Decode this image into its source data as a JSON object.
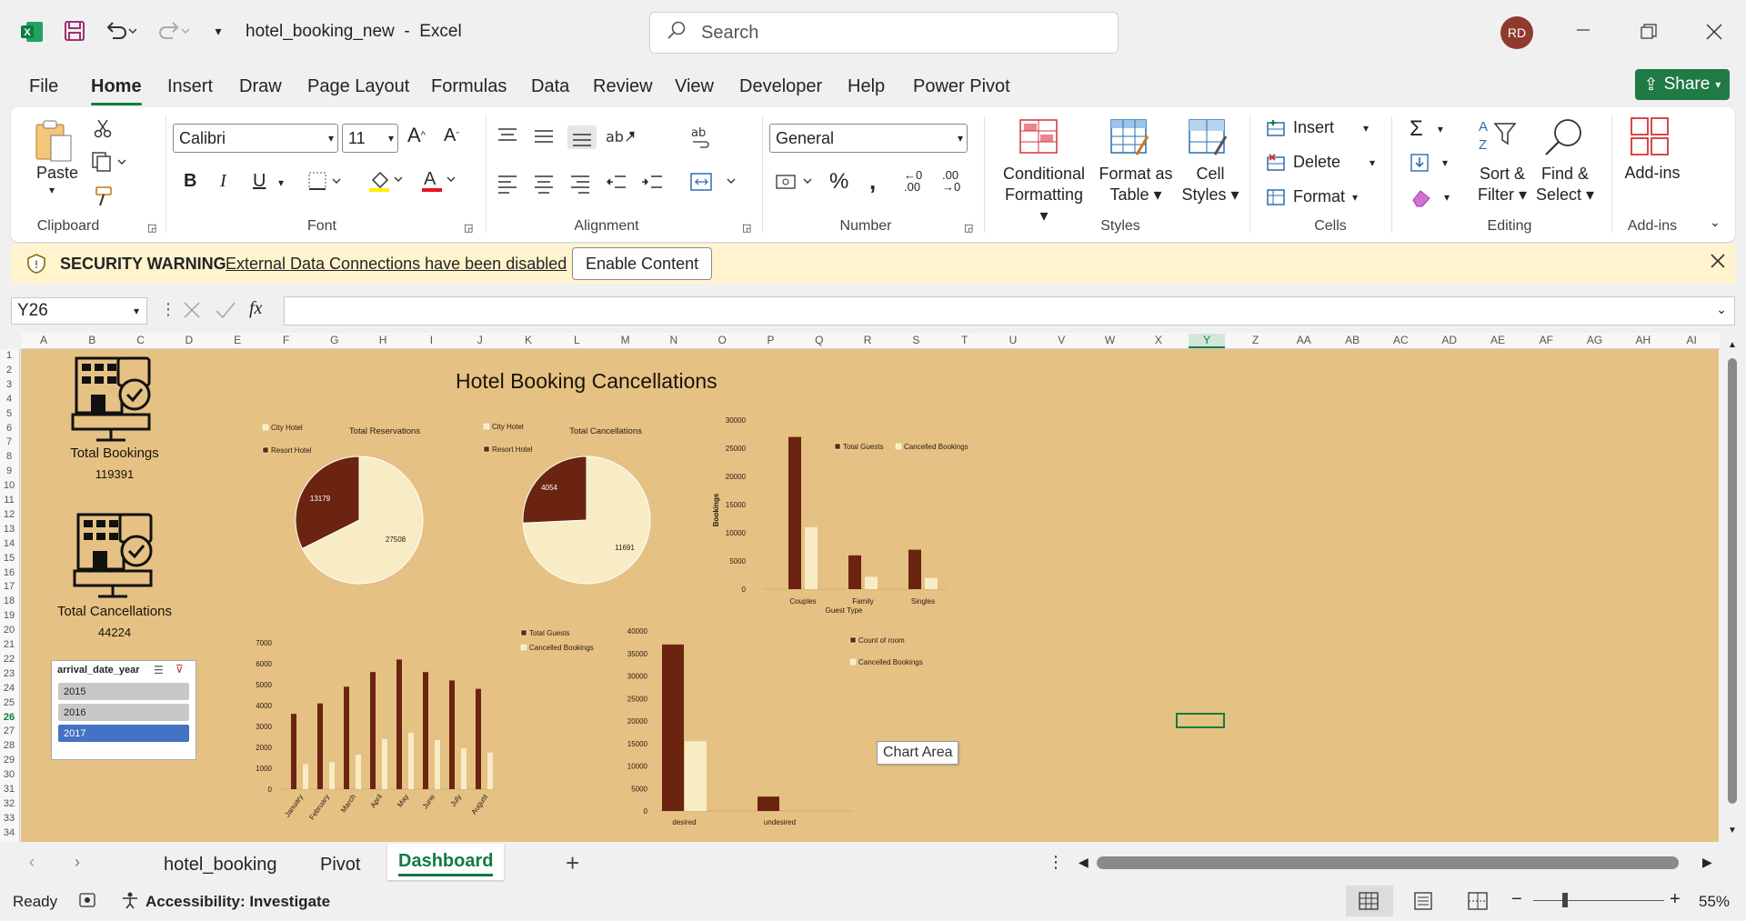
{
  "app": {
    "title": "hotel_booking_new",
    "app_name": "Excel",
    "title_sep": "-",
    "user_initials": "RD",
    "search_placeholder": "Search"
  },
  "menu_tabs": [
    "File",
    "Home",
    "Insert",
    "Draw",
    "Page Layout",
    "Formulas",
    "Data",
    "Review",
    "View",
    "Developer",
    "Help",
    "Power Pivot"
  ],
  "share_label": "Share",
  "ribbon": {
    "clipboard": {
      "paste": "Paste",
      "label": "Clipboard"
    },
    "font": {
      "name": "Calibri",
      "size": "11",
      "label": "Font",
      "bold": "B",
      "italic": "I",
      "underline": "U"
    },
    "alignment": {
      "label": "Alignment"
    },
    "number": {
      "format": "General",
      "label": "Number"
    },
    "styles": {
      "cond1": "Conditional",
      "cond2": "Formatting",
      "fmt1": "Format as",
      "fmt2": "Table",
      "cell1": "Cell",
      "cell2": "Styles",
      "label": "Styles"
    },
    "cells": {
      "insert": "Insert",
      "delete": "Delete",
      "format": "Format",
      "label": "Cells"
    },
    "editing": {
      "sort1": "Sort &",
      "sort2": "Filter",
      "find1": "Find &",
      "find2": "Select",
      "label": "Editing"
    },
    "addins": {
      "btn": "Add-ins",
      "label": "Add-ins"
    }
  },
  "warning": {
    "title": "SECURITY WARNING",
    "message": "External Data Connections have been disabled",
    "button": "Enable Content"
  },
  "formula_bar": {
    "name_box": "Y26",
    "fx": "fx",
    "value": ""
  },
  "columns": [
    "A",
    "B",
    "C",
    "D",
    "E",
    "F",
    "G",
    "H",
    "I",
    "J",
    "K",
    "L",
    "M",
    "N",
    "O",
    "P",
    "Q",
    "R",
    "S",
    "T",
    "U",
    "V",
    "W",
    "X",
    "Y",
    "Z",
    "AA",
    "AB",
    "AC",
    "AD",
    "AE",
    "AF",
    "AG",
    "AH",
    "AI"
  ],
  "rows": [
    "1",
    "2",
    "3",
    "4",
    "5",
    "6",
    "7",
    "8",
    "9",
    "10",
    "11",
    "12",
    "13",
    "14",
    "15",
    "16",
    "17",
    "18",
    "19",
    "20",
    "21",
    "22",
    "23",
    "24",
    "25",
    "26",
    "27",
    "28",
    "29",
    "30",
    "31",
    "32",
    "33",
    "34"
  ],
  "dashboard": {
    "title": "Hotel Booking Cancellations",
    "kpi1": {
      "label": "Total Bookings",
      "value": "119391"
    },
    "kpi2": {
      "label": "Total Cancellations",
      "value": "44224"
    },
    "slicer": {
      "title": "arrival_date_year",
      "items": [
        "2015",
        "2016",
        "2017"
      ],
      "selected": "2017"
    },
    "tooltip": "Chart Area"
  },
  "colors": {
    "dark": "#6b2410",
    "light": "#f8ecc4",
    "sheet_bg": "#e5c184",
    "excel_green": "#107c41"
  },
  "chart_data": [
    {
      "type": "pie",
      "title": "Total Reservations",
      "legend": [
        "City Hotel",
        "Resort Hotel"
      ],
      "values": [
        27508,
        13179
      ],
      "labels": [
        "27508",
        "13179"
      ]
    },
    {
      "type": "pie",
      "title": "Total Cancellations",
      "legend": [
        "City Hotel",
        "Resort Hotel"
      ],
      "values": [
        11691,
        4054
      ],
      "labels": [
        "11691",
        "4054"
      ]
    },
    {
      "type": "bar",
      "categories": [
        "Couples",
        "Family",
        "Singles"
      ],
      "xlabel": "Guest Type",
      "ylabel": "Bookings",
      "ylim": [
        0,
        30000
      ],
      "yticks": [
        "0",
        "5000",
        "10000",
        "15000",
        "20000",
        "25000",
        "30000"
      ],
      "series": [
        {
          "name": "Total Guests",
          "values": [
            27000,
            6000,
            7000
          ]
        },
        {
          "name": "Cancelled Bookings",
          "values": [
            11000,
            2200,
            2000
          ]
        }
      ]
    },
    {
      "type": "bar",
      "categories": [
        "January",
        "February",
        "March",
        "April",
        "May",
        "June",
        "July",
        "August"
      ],
      "ylim": [
        0,
        7000
      ],
      "yticks": [
        "0",
        "1000",
        "2000",
        "3000",
        "4000",
        "5000",
        "6000",
        "7000"
      ],
      "series": [
        {
          "name": "Total Guests",
          "values": [
            3600,
            4100,
            4900,
            5600,
            6200,
            5600,
            5200,
            4800
          ]
        },
        {
          "name": "Cancelled Bookings",
          "values": [
            1200,
            1300,
            1650,
            2400,
            2700,
            2350,
            1950,
            1750
          ]
        }
      ]
    },
    {
      "type": "bar",
      "categories": [
        "desired",
        "undesired"
      ],
      "ylim": [
        0,
        40000
      ],
      "yticks": [
        "0",
        "5000",
        "10000",
        "15000",
        "20000",
        "25000",
        "30000",
        "35000",
        "40000"
      ],
      "series": [
        {
          "name": "Count of room",
          "values": [
            37000,
            3200
          ]
        },
        {
          "name": "Cancelled Bookings",
          "values": [
            15500,
            0
          ]
        }
      ]
    }
  ],
  "sheet_tabs": [
    "hotel_booking",
    "Pivot",
    "Dashboard"
  ],
  "active_sheet": "Dashboard",
  "status": {
    "ready": "Ready",
    "accessibility": "Accessibility: Investigate",
    "zoom": "55%"
  }
}
